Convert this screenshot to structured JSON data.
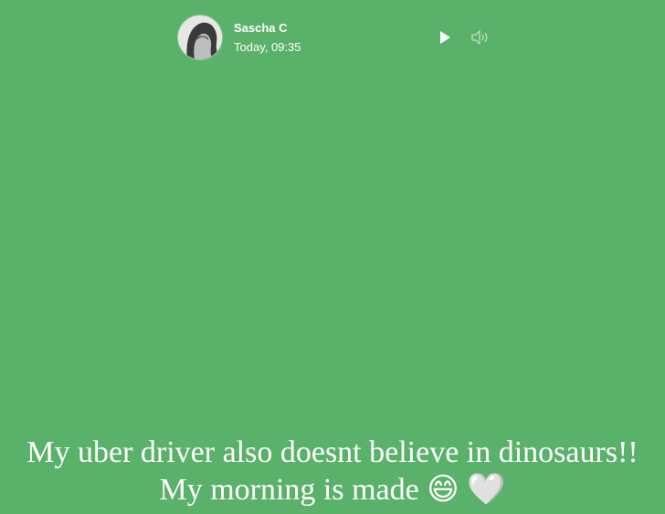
{
  "story": {
    "author": "Sascha C",
    "timestamp": "Today, 09:35",
    "background_color": "#5ab169",
    "text_color": "#ffffff",
    "caption_line1": "My uber driver also doesnt believe in dinosaurs!!",
    "caption_line2": "My morning is made",
    "emoji_1": "😄",
    "emoji_2": "🤍"
  },
  "controls": {
    "play_icon": "play-icon",
    "volume_icon": "volume-icon"
  }
}
